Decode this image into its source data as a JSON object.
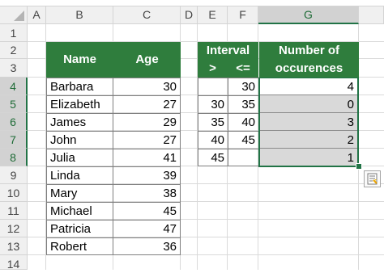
{
  "columns": [
    "A",
    "B",
    "C",
    "D",
    "E",
    "F",
    "G"
  ],
  "selected_column": "G",
  "rows": [
    "1",
    "2",
    "3",
    "4",
    "5",
    "6",
    "7",
    "8",
    "9",
    "10",
    "11",
    "12",
    "13",
    "14"
  ],
  "selected_rows": [
    "4",
    "5",
    "6",
    "7",
    "8"
  ],
  "table1": {
    "header_name": "Name",
    "header_age": "Age",
    "records": [
      {
        "name": "Barbara",
        "age": "30"
      },
      {
        "name": "Elizabeth",
        "age": "27"
      },
      {
        "name": "James",
        "age": "29"
      },
      {
        "name": "John",
        "age": "27"
      },
      {
        "name": "Julia",
        "age": "41"
      },
      {
        "name": "Linda",
        "age": "39"
      },
      {
        "name": "Mary",
        "age": "38"
      },
      {
        "name": "Michael",
        "age": "45"
      },
      {
        "name": "Patricia",
        "age": "47"
      },
      {
        "name": "Robert",
        "age": "36"
      }
    ]
  },
  "table2": {
    "header_interval": "Interval",
    "header_gt": ">",
    "header_le": "<=",
    "header_count_line1": "Number of",
    "header_count_line2": "occurences",
    "rows": [
      {
        "gt": "",
        "le": "30",
        "count": "4"
      },
      {
        "gt": "30",
        "le": "35",
        "count": "0"
      },
      {
        "gt": "35",
        "le": "40",
        "count": "3"
      },
      {
        "gt": "40",
        "le": "45",
        "count": "2"
      },
      {
        "gt": "45",
        "le": "",
        "count": "1"
      }
    ]
  },
  "colors": {
    "header_green": "#2f7d3d",
    "selection_green": "#217346",
    "selection_fill": "#d9d9d9"
  },
  "icons": {
    "quick_analysis": "quick-analysis-icon"
  }
}
